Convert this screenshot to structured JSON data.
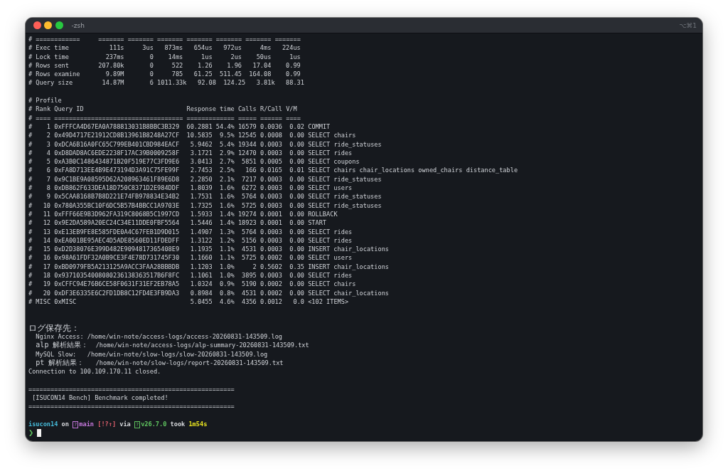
{
  "window": {
    "title": "-zsh",
    "shortcut": "⌥⌘1"
  },
  "stats": {
    "separator": {
      "label": "# ============",
      "values": [
        "=======",
        "=======",
        "=======",
        "=======",
        "=======",
        "=======",
        "======="
      ]
    },
    "rows": [
      {
        "label": "# Exec time",
        "values": [
          "111s",
          "3us",
          "873ms",
          "654us",
          "972us",
          "4ms",
          "224us"
        ]
      },
      {
        "label": "# Lock time",
        "values": [
          "237ms",
          "0",
          "14ms",
          "1us",
          "2us",
          "50us",
          "1us"
        ]
      },
      {
        "label": "# Rows sent",
        "values": [
          "207.80k",
          "0",
          "522",
          "1.26",
          "1.96",
          "17.04",
          "0.99"
        ]
      },
      {
        "label": "# Rows examine",
        "values": [
          "9.89M",
          "0",
          "785",
          "61.25",
          "511.45",
          "164.08",
          "0.99"
        ]
      },
      {
        "label": "# Query size",
        "values": [
          "14.87M",
          "6",
          "1011.33k",
          "92.08",
          "124.25",
          "3.81k",
          "88.31"
        ]
      }
    ]
  },
  "profile": {
    "title": "# Profile",
    "header": {
      "mark": "#",
      "rank": "Rank",
      "query_id": "Query ID",
      "response_time": "Response time",
      "calls": "Calls",
      "r_call": "R/Call",
      "v_m": "V/M"
    },
    "separator": {
      "mark": "#",
      "rank": "====",
      "query_id": "===================================",
      "response_time": "=============",
      "calls": "=====",
      "r_call": "======",
      "v_m": "===="
    },
    "rows": [
      {
        "mark": "#",
        "rank": "1",
        "query_id": "0xFFFCA4D67EA0A788813031B8BBC3B329",
        "response_time": "60.2881",
        "share": "54.4%",
        "calls": "16579",
        "r_call": "0.0036",
        "v_m": "0.02",
        "item": "COMMIT"
      },
      {
        "mark": "#",
        "rank": "2",
        "query_id": "0x49D4717E21912CD8B13961B8248A27CF",
        "response_time": "10.5835",
        "share": "9.5%",
        "calls": "12545",
        "r_call": "0.0008",
        "v_m": "0.00",
        "item": "SELECT chairs"
      },
      {
        "mark": "#",
        "rank": "3",
        "query_id": "0xDCA6B16A0FC65C799EB401CBD984EACF",
        "response_time": "5.9462",
        "share": "5.4%",
        "calls": "19344",
        "r_call": "0.0003",
        "v_m": "0.00",
        "item": "SELECT ride_statuses"
      },
      {
        "mark": "#",
        "rank": "4",
        "query_id": "0xD8DAD8AC6EDE2238F17AC39B0009258F",
        "response_time": "3.1721",
        "share": "2.9%",
        "calls": "12470",
        "r_call": "0.0003",
        "v_m": "0.00",
        "item": "SELECT rides"
      },
      {
        "mark": "#",
        "rank": "5",
        "query_id": "0xA3B0C1486434871B20F519E77C3FD9E6",
        "response_time": "3.0413",
        "share": "2.7%",
        "calls": "5851",
        "r_call": "0.0005",
        "v_m": "0.00",
        "item": "SELECT coupons"
      },
      {
        "mark": "#",
        "rank": "6",
        "query_id": "0xFA8D713EE4B9E473194D3A91C75FE99F",
        "response_time": "2.7453",
        "share": "2.5%",
        "calls": "166",
        "r_call": "0.0165",
        "v_m": "0.01",
        "item": "SELECT chairs chair_locations owned_chairs distance_table"
      },
      {
        "mark": "#",
        "rank": "7",
        "query_id": "0x9C1BE9A08595D62A208963461F89E6D8",
        "response_time": "2.2850",
        "share": "2.1%",
        "calls": "7217",
        "r_call": "0.0003",
        "v_m": "0.00",
        "item": "SELECT ride_statuses"
      },
      {
        "mark": "#",
        "rank": "8",
        "query_id": "0xDB862F633DEA18D750C8371D2E984DDF",
        "response_time": "1.8039",
        "share": "1.6%",
        "calls": "6272",
        "r_call": "0.0003",
        "v_m": "0.00",
        "item": "SELECT users"
      },
      {
        "mark": "#",
        "rank": "9",
        "query_id": "0x5CAA8168B7B8D221E74FB978834E34B2",
        "response_time": "1.7531",
        "share": "1.6%",
        "calls": "5764",
        "r_call": "0.0003",
        "v_m": "0.00",
        "item": "SELECT ride_statuses"
      },
      {
        "mark": "#",
        "rank": "10",
        "query_id": "0x780A355BC10F6DC5B57B4BBCC1A9703E",
        "response_time": "1.7325",
        "share": "1.6%",
        "calls": "5725",
        "r_call": "0.0003",
        "v_m": "0.00",
        "item": "SELECT ride_statuses"
      },
      {
        "mark": "#",
        "rank": "11",
        "query_id": "0xFFF66E9B3D962FA319C8068B5C1997CD",
        "response_time": "1.5933",
        "share": "1.4%",
        "calls": "19274",
        "r_call": "0.0001",
        "v_m": "0.00",
        "item": "ROLLBACK"
      },
      {
        "mark": "#",
        "rank": "12",
        "query_id": "0x9E2DA589A20EC24C34E11DDE0FBF5564",
        "response_time": "1.5446",
        "share": "1.4%",
        "calls": "18923",
        "r_call": "0.0001",
        "v_m": "0.00",
        "item": "START"
      },
      {
        "mark": "#",
        "rank": "13",
        "query_id": "0xE13EB9FE8E585FDE0A4C67FEB1D9D015",
        "response_time": "1.4907",
        "share": "1.3%",
        "calls": "5764",
        "r_call": "0.0003",
        "v_m": "0.00",
        "item": "SELECT rides"
      },
      {
        "mark": "#",
        "rank": "14",
        "query_id": "0xEA001BE95AEC4D5ADE8560ED11FDEDFF",
        "response_time": "1.3122",
        "share": "1.2%",
        "calls": "5156",
        "r_call": "0.0003",
        "v_m": "0.00",
        "item": "SELECT rides"
      },
      {
        "mark": "#",
        "rank": "15",
        "query_id": "0xD2D38076E399D482E9094817365408E9",
        "response_time": "1.1935",
        "share": "1.1%",
        "calls": "4531",
        "r_call": "0.0003",
        "v_m": "0.00",
        "item": "INSERT chair_locations"
      },
      {
        "mark": "#",
        "rank": "16",
        "query_id": "0x98A61FDF32A0B9CE3F4E78D731745F30",
        "response_time": "1.1660",
        "share": "1.1%",
        "calls": "5725",
        "r_call": "0.0002",
        "v_m": "0.00",
        "item": "SELECT users"
      },
      {
        "mark": "#",
        "rank": "17",
        "query_id": "0xBD0979FB5A213125A9ACC3FAA28BBBDB",
        "response_time": "1.1203",
        "share": "1.0%",
        "calls": "2",
        "r_call": "0.5602",
        "v_m": "0.35",
        "item": "INSERT chair_locations"
      },
      {
        "mark": "#",
        "rank": "18",
        "query_id": "0x93710354008080236138363517B6F8FC",
        "response_time": "1.1061",
        "share": "1.0%",
        "calls": "3895",
        "r_call": "0.0003",
        "v_m": "0.00",
        "item": "SELECT rides"
      },
      {
        "mark": "#",
        "rank": "19",
        "query_id": "0xCFFC94E76B6CE58F0631F31EF2EB78A5",
        "response_time": "1.0324",
        "share": "0.9%",
        "calls": "5190",
        "r_call": "0.0002",
        "v_m": "0.00",
        "item": "SELECT chairs"
      },
      {
        "mark": "#",
        "rank": "20",
        "query_id": "0xDF3E6335E6C2FD1DB8C12FD4E3FB9DA3",
        "response_time": "0.8984",
        "share": "0.8%",
        "calls": "4531",
        "r_call": "0.0002",
        "v_m": "0.00",
        "item": "SELECT chair_locations"
      },
      {
        "mark": "#",
        "rank": "MISC",
        "query_id": "0xMISC",
        "response_time": "5.0455",
        "share": "4.6%",
        "calls": "4356",
        "r_call": "0.0012",
        "v_m": "0.0",
        "item": "<102 ITEMS>"
      }
    ]
  },
  "logs": {
    "title": "ログ保存先：",
    "entries": [
      {
        "label": "Nginx Access:",
        "path": "/home/win-note/access-logs/access-20260831-143509.log"
      },
      {
        "label": "alp 解析結果：",
        "path": "/home/win-note/access-logs/alp-summary-20260831-143509.txt"
      },
      {
        "label": "MySQL Slow:",
        "path": "/home/win-note/slow-logs/slow-20260831-143509.log"
      },
      {
        "label": "pt 解析結果：",
        "path": "/home/win-note/slow-logs/report-20260831-143509.txt"
      }
    ]
  },
  "connection": "Connection to 100.109.170.11 closed.",
  "banner": {
    "rule_top": "========================================================",
    "message": "[ISUCON14 Bench] Benchmark completed!",
    "rule_bottom": "========================================================"
  },
  "prompt": {
    "parts": [
      {
        "text": "isucon14",
        "color": "#45b8d6"
      },
      {
        "text": "on",
        "color": "#d4d6da"
      },
      {
        "glyph": "?",
        "text": "main",
        "color": "#c678dd"
      },
      {
        "text": "[!?↑]",
        "color": "#e0606e"
      },
      {
        "text": "via",
        "color": "#d4d6da"
      },
      {
        "glyph": "?",
        "text": "v26.7.0",
        "color": "#5fc35f"
      },
      {
        "text": "took",
        "color": "#d4d6da"
      },
      {
        "text": "1m54s",
        "color": "#e5e020"
      }
    ],
    "symbol": {
      "text": "❯",
      "color": "#5fc35f"
    }
  }
}
